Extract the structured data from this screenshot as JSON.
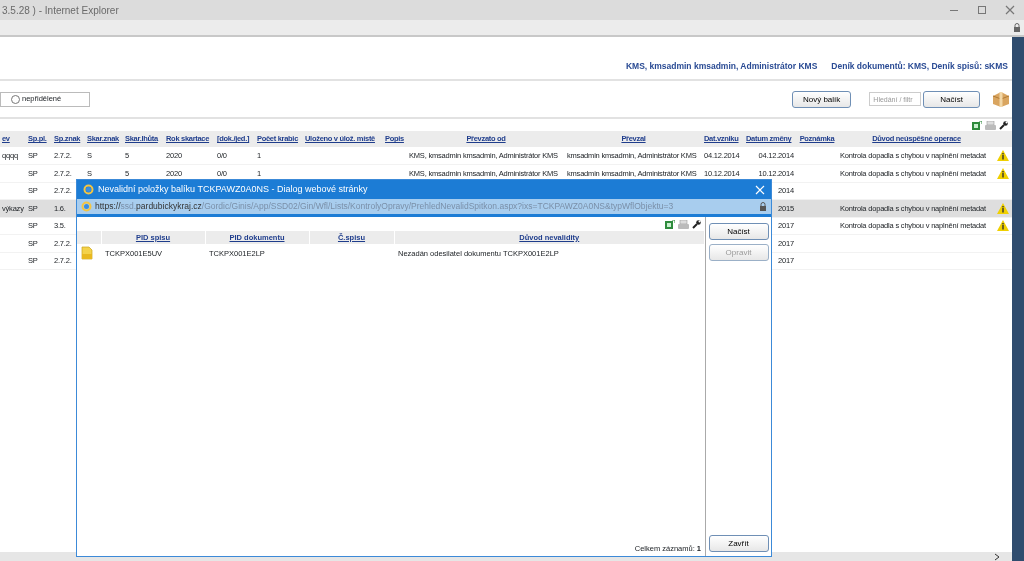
{
  "window": {
    "title": "3.5.28 ) - Internet Explorer"
  },
  "header": {
    "user": "KMS, kmsadmin kmsadmin, Administrátor KMS",
    "journal": "Deník dokumentů: KMS, Deník spisů: sKMS"
  },
  "filter": {
    "radio_label": "nepřidělené",
    "selected": false
  },
  "toolbar": {
    "new_button": "Nový balík",
    "search": {
      "placeholder": "Hledání / filtr"
    },
    "load_button": "Načíst"
  },
  "table": {
    "columns": [
      "ev",
      "Sp.pl.",
      "Sp.znak",
      "Skar.znak",
      "Skar.lhůta",
      "Rok skartace",
      "[dok./jed.]",
      "Počet krabic",
      "Uloženo v úlož. místě",
      "Popis",
      "Převzato od",
      "Převzal",
      "Dat.vzniku",
      "Datum změny",
      "Poznámka",
      "Důvod neúspěšné operace"
    ],
    "rows": [
      {
        "selected": false,
        "warning": true,
        "cells": [
          "qqqq",
          "SP",
          "2.7.2.",
          "S",
          "5",
          "2020",
          "0/0",
          "1",
          null,
          null,
          "KMS, kmsadmin kmsadmin, Administrátor KMS",
          "kmsadmin kmsadmin, Administrátor KMS",
          "04.12.2014",
          "04.12.2014",
          null,
          "Kontrola dopadla s chybou v naplnění metadat"
        ]
      },
      {
        "selected": false,
        "warning": true,
        "cells": [
          null,
          "SP",
          "2.7.2.",
          "S",
          "5",
          "2020",
          "0/0",
          "1",
          null,
          null,
          "KMS, kmsadmin kmsadmin, Administrátor KMS",
          "kmsadmin kmsadmin, Administrátor KMS",
          "10.12.2014",
          "10.12.2014",
          null,
          "Kontrola dopadla s chybou v naplnění metadat"
        ]
      },
      {
        "selected": false,
        "warning": false,
        "cells": [
          null,
          "SP",
          "2.7.2.",
          null,
          null,
          null,
          null,
          null,
          null,
          null,
          null,
          null,
          null,
          "2014",
          null,
          null
        ]
      },
      {
        "selected": true,
        "warning": true,
        "cells": [
          "výkazy",
          "SP",
          "1.6.",
          null,
          null,
          null,
          null,
          null,
          null,
          null,
          null,
          null,
          null,
          "2015",
          null,
          "Kontrola dopadla s chybou v naplnění metadat"
        ]
      },
      {
        "selected": false,
        "warning": true,
        "cells": [
          null,
          "SP",
          "3.5.",
          null,
          null,
          null,
          null,
          null,
          null,
          null,
          null,
          null,
          null,
          "2017",
          null,
          "Kontrola dopadla s chybou v naplnění metadat"
        ]
      },
      {
        "selected": false,
        "warning": false,
        "cells": [
          null,
          "SP",
          "2.7.2.",
          null,
          null,
          null,
          null,
          null,
          null,
          null,
          null,
          null,
          null,
          "2017",
          null,
          null
        ]
      },
      {
        "selected": false,
        "warning": false,
        "cells": [
          null,
          "SP",
          "2.7.2.",
          null,
          null,
          null,
          null,
          null,
          null,
          null,
          null,
          null,
          null,
          "2017",
          null,
          null
        ]
      }
    ]
  },
  "dialog": {
    "title": "Nevalidní položky balíku TCKPAWZ0A0NS - Dialog webové stránky",
    "url_parts": [
      {
        "text": "https://",
        "emphasis": true
      },
      {
        "text": "ssd.",
        "emphasis": false
      },
      {
        "text": "pardubickykraj.cz",
        "emphasis": true
      },
      {
        "text": "/Gordic/Ginis/App/SSD02/Gin/Wfl/Lists/KontrolyOpravy/PrehledNevalidSpitkon.aspx?ixs=TCKPAWZ0A0NS&typWflObjektu=3",
        "emphasis": false
      }
    ],
    "columns": [
      "PID spisu",
      "PID dokumentu",
      "Č.spisu",
      "Důvod nevalidity"
    ],
    "rows": [
      {
        "cells": [
          "TCKPX001E5UV",
          "TCKPX001E2LP",
          null,
          "Nezadán odesilatel dokumentu TCKPX001E2LP"
        ]
      }
    ],
    "total": "Celkem záznamů: **1**",
    "buttons": [
      {
        "label": "Načíst",
        "disabled": false
      },
      {
        "label": "Opravit",
        "disabled": true
      }
    ],
    "close_button": "Zavřít"
  }
}
